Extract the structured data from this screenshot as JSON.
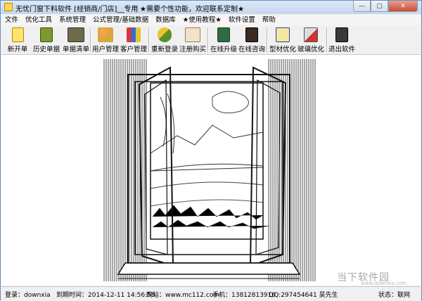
{
  "window": {
    "title": "无忧门窗下料软件 [经销商/门店]__专用",
    "notice": "★需要个性功能，欢迎联系定制★"
  },
  "menu": [
    "文件",
    "优化工具",
    "系统管理",
    "公式管理/基础数据",
    "数据库",
    "★使用教程★",
    "软件设置",
    "帮助"
  ],
  "toolbar": {
    "new_order": "新开单",
    "history_orders": "历史单据",
    "order_list": "单据清单",
    "user_mgmt": "用户管理",
    "customer_mgmt": "客户管理",
    "relogin": "重新登录",
    "register": "注册购买",
    "online_upgrade": "在线升级",
    "online_consult": "在线咨询",
    "profile_opt": "型材优化",
    "glass_opt": "玻璃优化",
    "exit": "退出软件"
  },
  "status": {
    "login": "登录：downxia",
    "expiry": "到期时间：2014-12-11 14:56:58",
    "website": "网站：www.mc112.com",
    "phone": "手机：13812813910",
    "qq": "QQ:297454641 吴先生",
    "state": "状态：联网"
  },
  "watermark": {
    "name": "当下软件园",
    "domain": "www.downxia.com"
  },
  "colors": {
    "title_gradient_top": "#dbe8f7",
    "close_button": "#c84a35",
    "toolbar_bg": "#f0f0f0"
  }
}
